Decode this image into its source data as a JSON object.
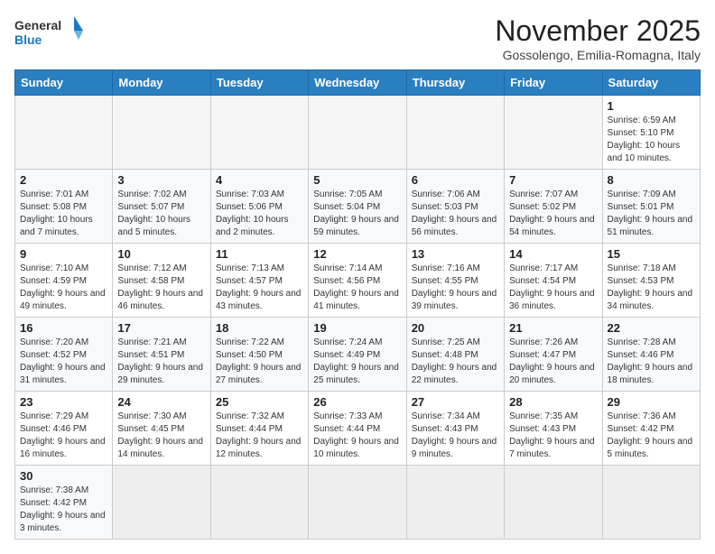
{
  "logo": {
    "general": "General",
    "blue": "Blue"
  },
  "header": {
    "month": "November 2025",
    "location": "Gossolengo, Emilia-Romagna, Italy"
  },
  "weekdays": [
    "Sunday",
    "Monday",
    "Tuesday",
    "Wednesday",
    "Thursday",
    "Friday",
    "Saturday"
  ],
  "weeks": [
    [
      {
        "day": "",
        "info": ""
      },
      {
        "day": "",
        "info": ""
      },
      {
        "day": "",
        "info": ""
      },
      {
        "day": "",
        "info": ""
      },
      {
        "day": "",
        "info": ""
      },
      {
        "day": "",
        "info": ""
      },
      {
        "day": "1",
        "info": "Sunrise: 6:59 AM\nSunset: 5:10 PM\nDaylight: 10 hours and 10 minutes."
      }
    ],
    [
      {
        "day": "2",
        "info": "Sunrise: 7:01 AM\nSunset: 5:08 PM\nDaylight: 10 hours and 7 minutes."
      },
      {
        "day": "3",
        "info": "Sunrise: 7:02 AM\nSunset: 5:07 PM\nDaylight: 10 hours and 5 minutes."
      },
      {
        "day": "4",
        "info": "Sunrise: 7:03 AM\nSunset: 5:06 PM\nDaylight: 10 hours and 2 minutes."
      },
      {
        "day": "5",
        "info": "Sunrise: 7:05 AM\nSunset: 5:04 PM\nDaylight: 9 hours and 59 minutes."
      },
      {
        "day": "6",
        "info": "Sunrise: 7:06 AM\nSunset: 5:03 PM\nDaylight: 9 hours and 56 minutes."
      },
      {
        "day": "7",
        "info": "Sunrise: 7:07 AM\nSunset: 5:02 PM\nDaylight: 9 hours and 54 minutes."
      },
      {
        "day": "8",
        "info": "Sunrise: 7:09 AM\nSunset: 5:01 PM\nDaylight: 9 hours and 51 minutes."
      }
    ],
    [
      {
        "day": "9",
        "info": "Sunrise: 7:10 AM\nSunset: 4:59 PM\nDaylight: 9 hours and 49 minutes."
      },
      {
        "day": "10",
        "info": "Sunrise: 7:12 AM\nSunset: 4:58 PM\nDaylight: 9 hours and 46 minutes."
      },
      {
        "day": "11",
        "info": "Sunrise: 7:13 AM\nSunset: 4:57 PM\nDaylight: 9 hours and 43 minutes."
      },
      {
        "day": "12",
        "info": "Sunrise: 7:14 AM\nSunset: 4:56 PM\nDaylight: 9 hours and 41 minutes."
      },
      {
        "day": "13",
        "info": "Sunrise: 7:16 AM\nSunset: 4:55 PM\nDaylight: 9 hours and 39 minutes."
      },
      {
        "day": "14",
        "info": "Sunrise: 7:17 AM\nSunset: 4:54 PM\nDaylight: 9 hours and 36 minutes."
      },
      {
        "day": "15",
        "info": "Sunrise: 7:18 AM\nSunset: 4:53 PM\nDaylight: 9 hours and 34 minutes."
      }
    ],
    [
      {
        "day": "16",
        "info": "Sunrise: 7:20 AM\nSunset: 4:52 PM\nDaylight: 9 hours and 31 minutes."
      },
      {
        "day": "17",
        "info": "Sunrise: 7:21 AM\nSunset: 4:51 PM\nDaylight: 9 hours and 29 minutes."
      },
      {
        "day": "18",
        "info": "Sunrise: 7:22 AM\nSunset: 4:50 PM\nDaylight: 9 hours and 27 minutes."
      },
      {
        "day": "19",
        "info": "Sunrise: 7:24 AM\nSunset: 4:49 PM\nDaylight: 9 hours and 25 minutes."
      },
      {
        "day": "20",
        "info": "Sunrise: 7:25 AM\nSunset: 4:48 PM\nDaylight: 9 hours and 22 minutes."
      },
      {
        "day": "21",
        "info": "Sunrise: 7:26 AM\nSunset: 4:47 PM\nDaylight: 9 hours and 20 minutes."
      },
      {
        "day": "22",
        "info": "Sunrise: 7:28 AM\nSunset: 4:46 PM\nDaylight: 9 hours and 18 minutes."
      }
    ],
    [
      {
        "day": "23",
        "info": "Sunrise: 7:29 AM\nSunset: 4:46 PM\nDaylight: 9 hours and 16 minutes."
      },
      {
        "day": "24",
        "info": "Sunrise: 7:30 AM\nSunset: 4:45 PM\nDaylight: 9 hours and 14 minutes."
      },
      {
        "day": "25",
        "info": "Sunrise: 7:32 AM\nSunset: 4:44 PM\nDaylight: 9 hours and 12 minutes."
      },
      {
        "day": "26",
        "info": "Sunrise: 7:33 AM\nSunset: 4:44 PM\nDaylight: 9 hours and 10 minutes."
      },
      {
        "day": "27",
        "info": "Sunrise: 7:34 AM\nSunset: 4:43 PM\nDaylight: 9 hours and 9 minutes."
      },
      {
        "day": "28",
        "info": "Sunrise: 7:35 AM\nSunset: 4:43 PM\nDaylight: 9 hours and 7 minutes."
      },
      {
        "day": "29",
        "info": "Sunrise: 7:36 AM\nSunset: 4:42 PM\nDaylight: 9 hours and 5 minutes."
      }
    ],
    [
      {
        "day": "30",
        "info": "Sunrise: 7:38 AM\nSunset: 4:42 PM\nDaylight: 9 hours and 3 minutes."
      },
      {
        "day": "",
        "info": ""
      },
      {
        "day": "",
        "info": ""
      },
      {
        "day": "",
        "info": ""
      },
      {
        "day": "",
        "info": ""
      },
      {
        "day": "",
        "info": ""
      },
      {
        "day": "",
        "info": ""
      }
    ]
  ]
}
